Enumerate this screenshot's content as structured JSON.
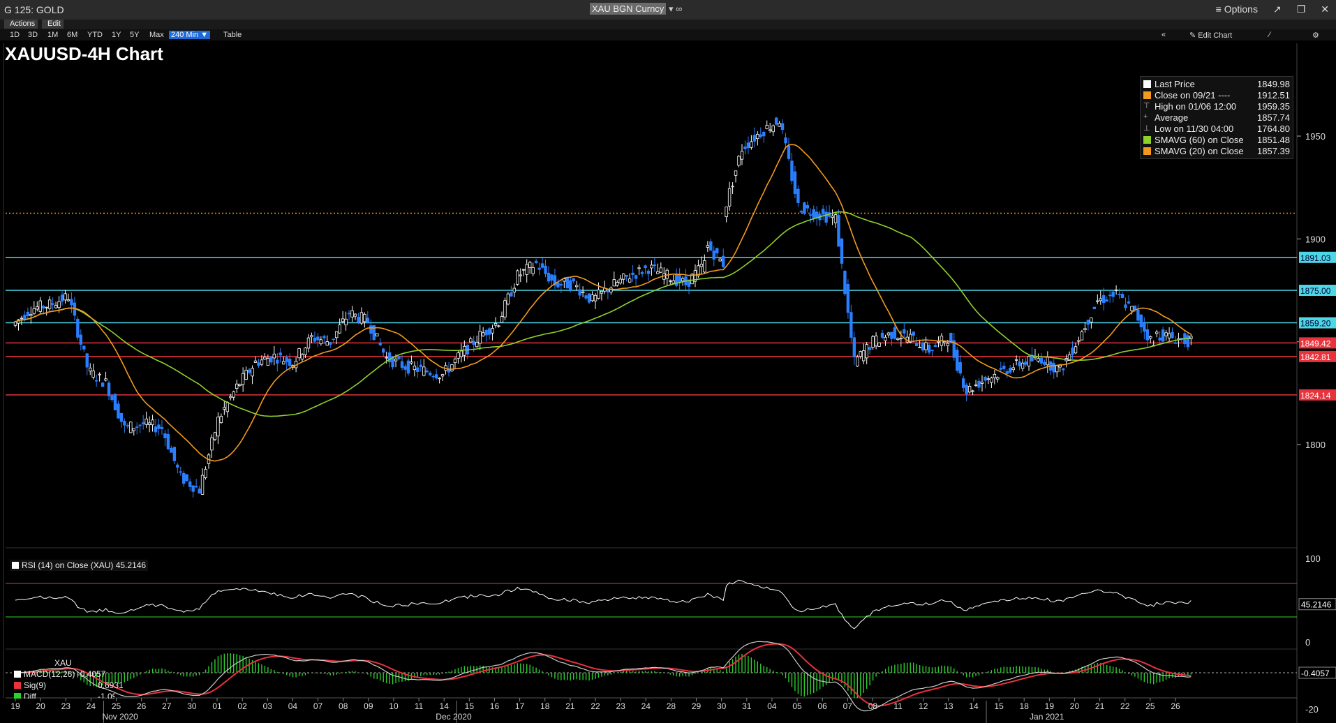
{
  "window": {
    "title": "G 125: GOLD",
    "security": "XAU BGN Curncy",
    "options_label": "Options"
  },
  "menu": {
    "actions": "Actions",
    "edit": "Edit"
  },
  "toolbar": {
    "timeframes": [
      "1D",
      "3D",
      "1M",
      "6M",
      "YTD",
      "1Y",
      "5Y",
      "Max"
    ],
    "active_timeframe": "240 Min",
    "table_label": "Table",
    "edit_chart_label": "Edit Chart"
  },
  "chart_title": "XAUUSD-4H Chart",
  "legend": [
    {
      "label": "Last Price",
      "value": "1849.98",
      "color": "#ffffff"
    },
    {
      "label": "Close on 09/21 ----",
      "value": "1912.51",
      "color": "#f39a1e"
    },
    {
      "label": "High on 01/06 12:00",
      "value": "1959.35",
      "color": "none",
      "icon": "high-marker-icon"
    },
    {
      "label": "Average",
      "value": "1857.74",
      "color": "none",
      "icon": "average-marker-icon"
    },
    {
      "label": "Low on 11/30 04:00",
      "value": "1764.80",
      "color": "none",
      "icon": "low-marker-icon"
    },
    {
      "label": "SMAVG (60)  on Close",
      "value": "1851.48",
      "color": "#8fd12a"
    },
    {
      "label": "SMAVG (20)  on Close",
      "value": "1857.39",
      "color": "#f39a1e"
    }
  ],
  "rsi": {
    "label": "RSI (14)  on Close (XAU)",
    "value": "45.2146"
  },
  "macd": {
    "header": "XAU",
    "macd_label": "MACD(12,26)",
    "macd_value": "-0.4057",
    "sig_label": "Sig(9)",
    "sig_value": "0.6931",
    "diff_label": "Diff",
    "diff_value": "-1.0988"
  },
  "colors": {
    "up": "#ffffff",
    "down": "#2a7fff",
    "cyan_line": "#4dd7e6",
    "red_line": "#e8323c",
    "sma20": "#f39a1e",
    "sma60": "#8fd12a",
    "dotted_close": "#f39a1e"
  },
  "chart_data": {
    "type": "candlestick",
    "y_axis_ticks": [
      1800,
      1850,
      1900,
      1950
    ],
    "ylim": [
      1757,
      1972
    ],
    "horizontal_levels": [
      {
        "value": 1891.03,
        "label": "1891.03",
        "color": "#4dd7e6"
      },
      {
        "value": 1875.0,
        "label": "1875.00",
        "color": "#4dd7e6"
      },
      {
        "value": 1859.2,
        "label": "1859.20",
        "color": "#4dd7e6"
      },
      {
        "value": 1849.42,
        "label": "1849.42",
        "color": "#e8323c"
      },
      {
        "value": 1842.81,
        "label": "1842.81",
        "color": "#e8323c"
      },
      {
        "value": 1824.14,
        "label": "1824.14",
        "color": "#e8323c"
      }
    ],
    "close_line": 1912.51,
    "x_tick_labels": [
      "19",
      "20",
      "23",
      "24",
      "25",
      "26",
      "27",
      "30",
      "01",
      "02",
      "03",
      "04",
      "07",
      "08",
      "09",
      "10",
      "11",
      "14",
      "15",
      "16",
      "17",
      "18",
      "21",
      "22",
      "23",
      "24",
      "28",
      "29",
      "30",
      "31",
      "04",
      "05",
      "06",
      "07",
      "08",
      "11",
      "12",
      "13",
      "14",
      "15",
      "18",
      "19",
      "20",
      "21",
      "22",
      "25",
      "26"
    ],
    "month_labels": [
      {
        "label": "Nov 2020",
        "after_tick": 3
      },
      {
        "label": "Dec 2020",
        "after_tick": 17
      },
      {
        "label": "Jan 2021",
        "after_tick": 38
      }
    ],
    "daily_close": [
      1866,
      1868,
      1872,
      1838,
      1830,
      1808,
      1810,
      1808,
      1784,
      1778,
      1812,
      1828,
      1840,
      1843,
      1840,
      1852,
      1850,
      1864,
      1860,
      1842,
      1838,
      1836,
      1834,
      1844,
      1853,
      1860,
      1882,
      1888,
      1878,
      1878,
      1870,
      1877,
      1882,
      1886,
      1882,
      1878,
      1888,
      1888,
      1944,
      1952,
      1958,
      1916,
      1912,
      1910,
      1840,
      1850,
      1854,
      1852,
      1846,
      1852,
      1826,
      1832,
      1836,
      1840,
      1842,
      1836,
      1852,
      1870,
      1873,
      1864,
      1848,
      1852,
      1850
    ],
    "daily_open": [
      1858,
      1866,
      1868,
      1872,
      1836,
      1830,
      1808,
      1810,
      1808,
      1784,
      1778,
      1812,
      1828,
      1840,
      1843,
      1840,
      1852,
      1850,
      1864,
      1860,
      1842,
      1838,
      1836,
      1834,
      1844,
      1853,
      1860,
      1882,
      1888,
      1878,
      1878,
      1870,
      1877,
      1882,
      1886,
      1882,
      1878,
      1898,
      1912,
      1944,
      1952,
      1958,
      1916,
      1912,
      1910,
      1840,
      1850,
      1854,
      1852,
      1846,
      1852,
      1826,
      1832,
      1836,
      1840,
      1842,
      1836,
      1852,
      1870,
      1873,
      1864,
      1854,
      1852
    ],
    "series": [
      {
        "name": "RSI (14) on Close (XAU)",
        "ylim": [
          0,
          100
        ],
        "ticks": [
          0,
          100
        ],
        "upper_band": 70,
        "lower_band": 30,
        "last": 45.2146
      },
      {
        "name": "MACD(12,26)",
        "ticks": [
          -20
        ],
        "last": -0.4057
      }
    ]
  }
}
